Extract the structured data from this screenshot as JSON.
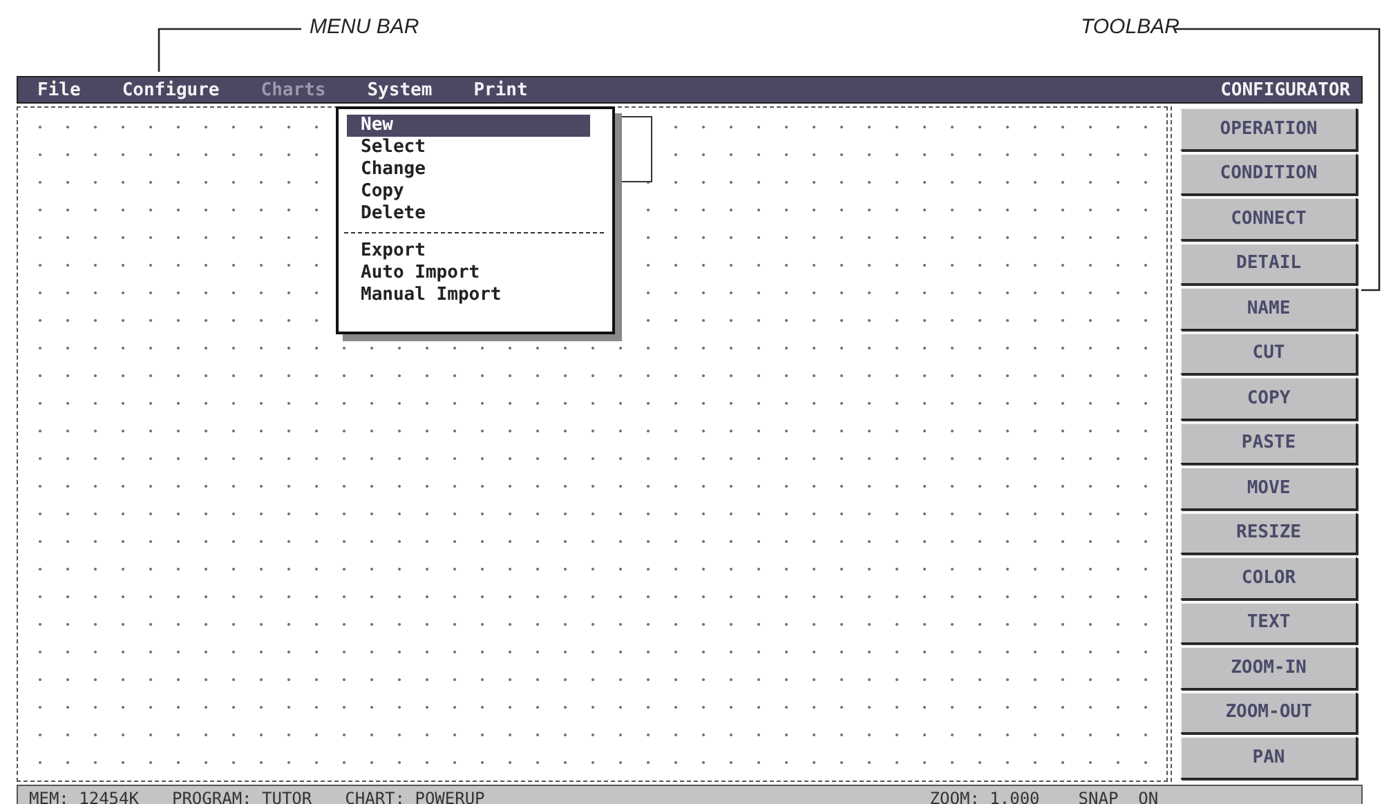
{
  "annotations": [
    {
      "label": "MENU BAR"
    },
    {
      "label": "TOOLBAR"
    }
  ],
  "menu_bar": {
    "items": [
      {
        "label": "File",
        "selected": false
      },
      {
        "label": "Configure",
        "selected": false
      },
      {
        "label": "Charts",
        "selected": true
      },
      {
        "label": "System",
        "selected": false
      },
      {
        "label": "Print",
        "selected": false
      }
    ],
    "title": "CONFIGURATOR"
  },
  "dropdown": {
    "groups": [
      [
        {
          "label": "New",
          "selected": true
        },
        {
          "label": "Select",
          "selected": false
        },
        {
          "label": "Change",
          "selected": false
        },
        {
          "label": "Copy",
          "selected": false
        },
        {
          "label": "Delete",
          "selected": false
        }
      ],
      [
        {
          "label": "Export",
          "selected": false
        },
        {
          "label": "Auto Import",
          "selected": false
        },
        {
          "label": "Manual Import",
          "selected": false
        }
      ]
    ]
  },
  "toolbar": {
    "buttons": [
      "OPERATION",
      "CONDITION",
      "CONNECT",
      "DETAIL",
      "NAME",
      "CUT",
      "COPY",
      "PASTE",
      "MOVE",
      "RESIZE",
      "COLOR",
      "TEXT",
      "ZOOM-IN",
      "ZOOM-OUT",
      "PAN"
    ]
  },
  "status_bar": {
    "fields": [
      "MEM: 12454K",
      "PROGRAM: TUTOR",
      "CHART: POWERUP",
      "ZOOM: 1.000",
      "SNAP  ON"
    ]
  }
}
